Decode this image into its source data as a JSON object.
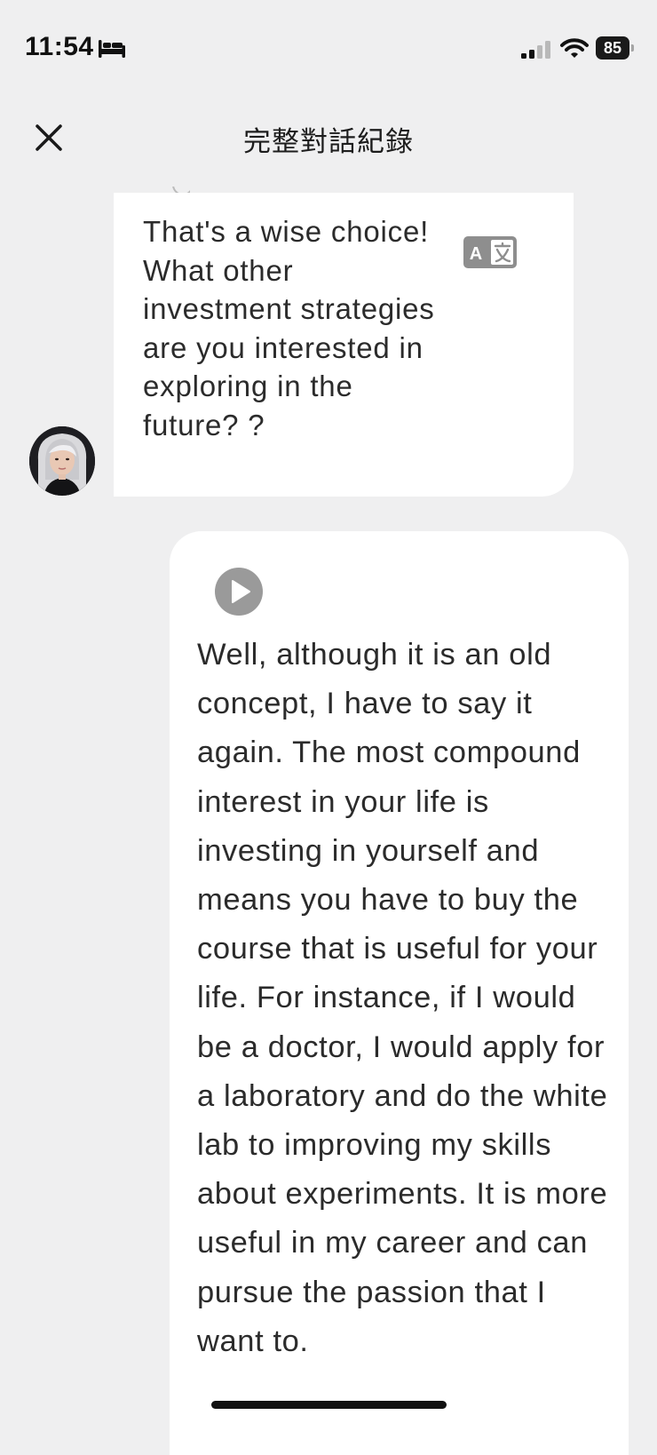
{
  "status_bar": {
    "time": "11:54",
    "battery_level": "85",
    "icons": [
      "bed-icon",
      "cellular-signal-icon",
      "wifi-icon",
      "battery-icon"
    ]
  },
  "header": {
    "title": "完整對話紀錄",
    "close_icon": "close-icon"
  },
  "conversation": {
    "incoming": {
      "text": "That's a wise choice! What other investment strategies are you interested in exploring in the future? ?",
      "translate_icon": "translate-icon",
      "avatar": "avatar"
    },
    "outgoing": {
      "play_icon": "play-icon",
      "text": "Well, although it is an old concept, I have to say it again. The most compound interest in your life is investing in yourself and means you have to buy the course that is useful for your life. For instance, if I would be a doctor, I would apply for a laboratory and do the white lab to improving my skills about experiments. It is more useful in my career and can pursue the passion that I want to."
    }
  },
  "colors": {
    "background": "#efeff0",
    "bubble": "#ffffff",
    "text": "#2b2b2b",
    "icon_gray": "#8e8e8e"
  }
}
